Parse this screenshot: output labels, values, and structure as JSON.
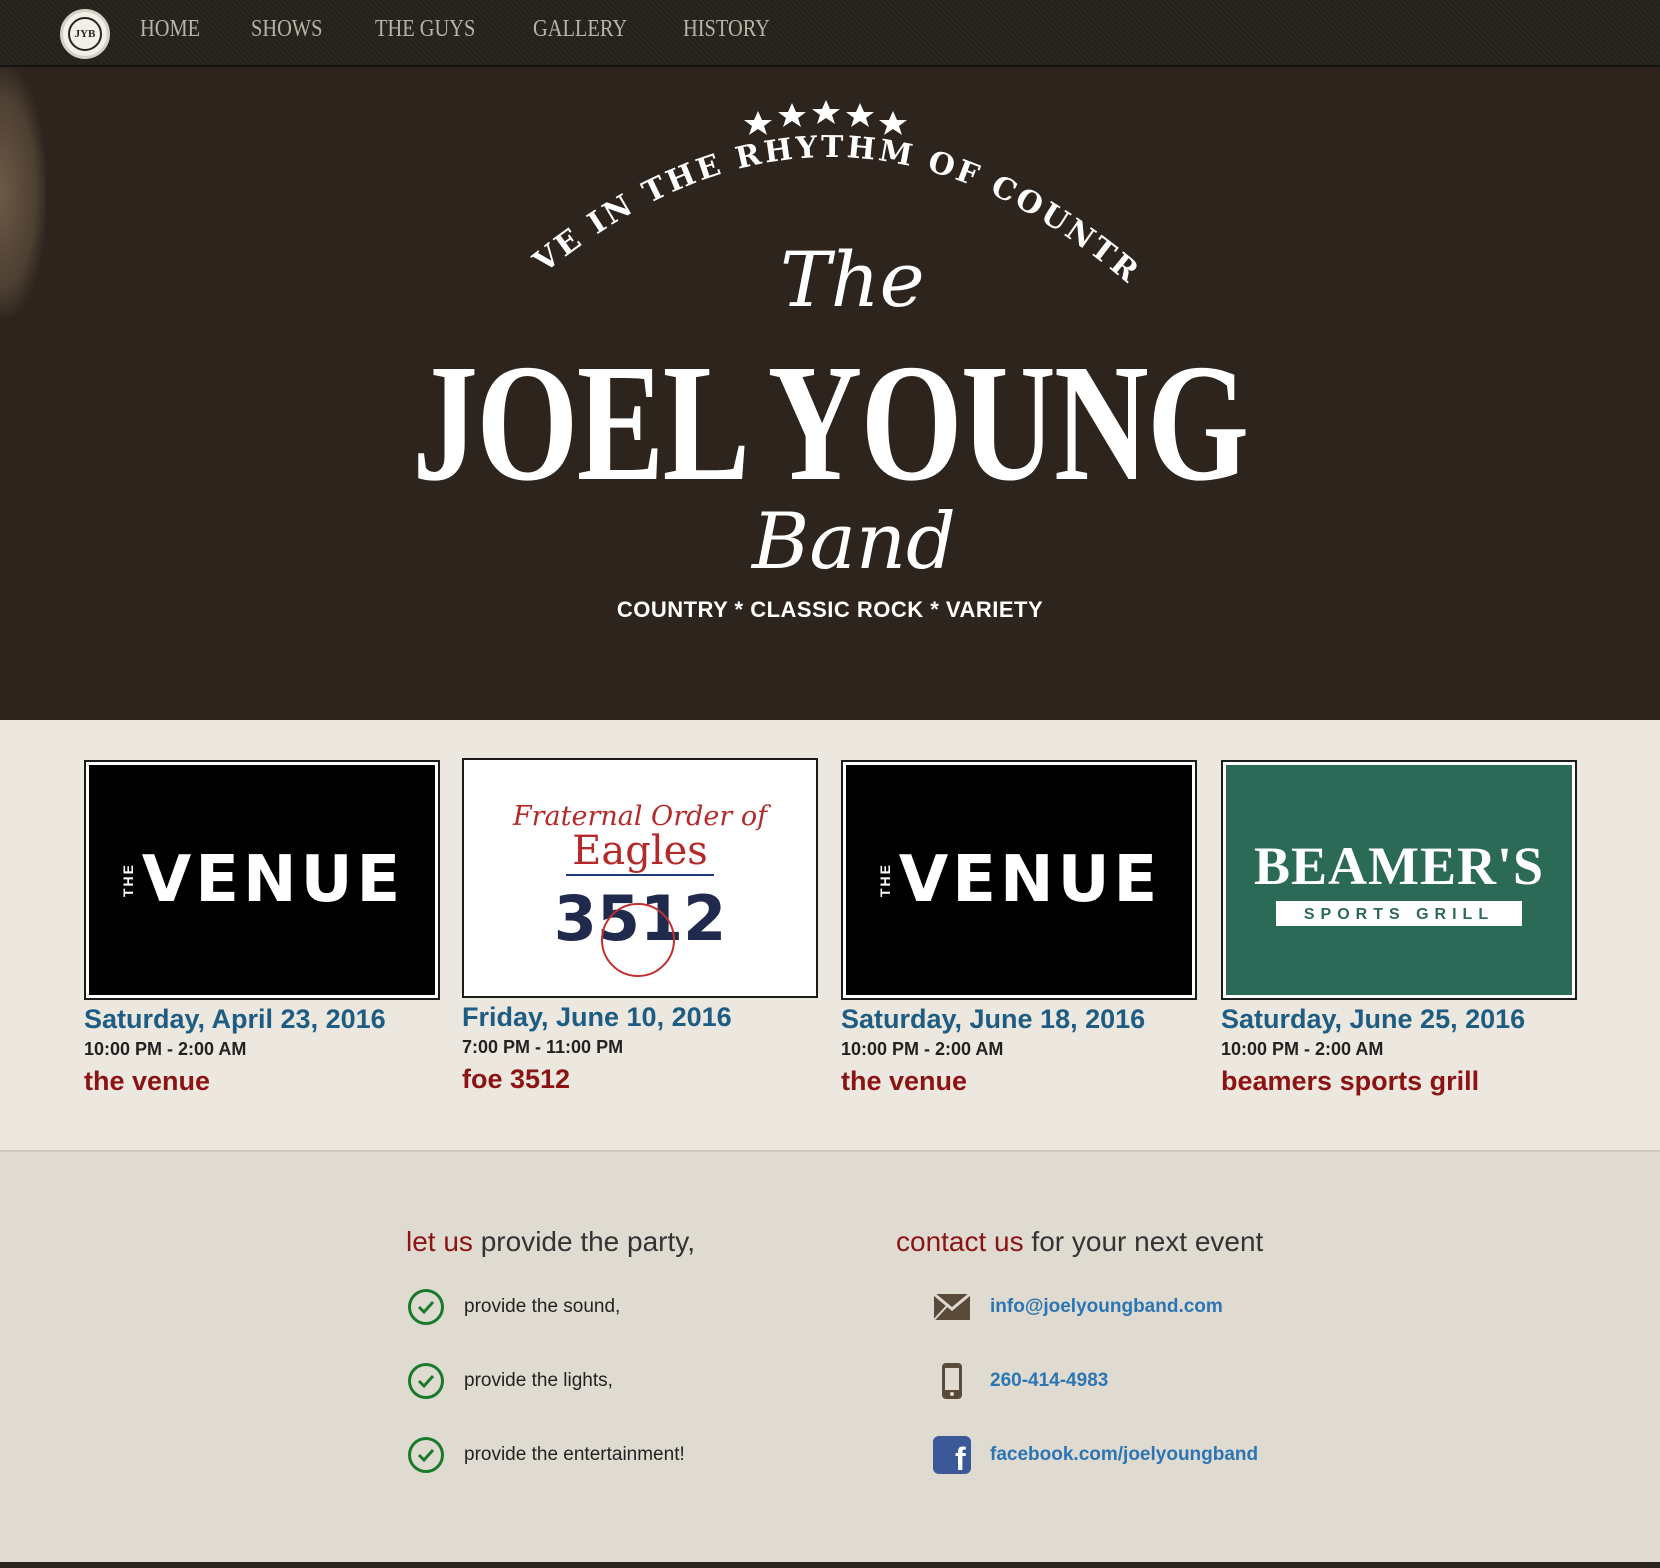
{
  "nav": {
    "logo_text": "JYB",
    "items": [
      {
        "label": "HOME"
      },
      {
        "label": "SHOWS"
      },
      {
        "label": "THE GUYS"
      },
      {
        "label": "GALLERY"
      },
      {
        "label": "HISTORY"
      }
    ]
  },
  "hero": {
    "arc_text": "LIVE IN THE RHYTHM OF COUNTRY",
    "the": "The",
    "name": "JOEL YOUNG",
    "band": "Band",
    "tagline": "COUNTRY * CLASSIC ROCK * VARIETY"
  },
  "shows": [
    {
      "logo": "venue",
      "logo_the": "THE",
      "logo_word": "VENUE",
      "date": "Saturday, April 23, 2016",
      "time": "10:00 PM - 2:00 AM",
      "place": "the venue"
    },
    {
      "logo": "eagles",
      "logo_line1": "Fraternal Order of",
      "logo_line2": "Eagles",
      "logo_num": "3512",
      "date": "Friday, June 10, 2016",
      "time": "7:00 PM - 11:00 PM",
      "place": "foe 3512"
    },
    {
      "logo": "venue",
      "logo_the": "THE",
      "logo_word": "VENUE",
      "date": "Saturday, June 18, 2016",
      "time": "10:00 PM - 2:00 AM",
      "place": "the venue"
    },
    {
      "logo": "beamers",
      "logo_line1": "BEAMER'S",
      "logo_line2": "SPORTS GRILL",
      "date": "Saturday, June 25, 2016",
      "time": "10:00 PM - 2:00 AM",
      "place": "beamers sports grill"
    }
  ],
  "cta": {
    "left": {
      "heading_red": "let us",
      "heading_rest": "provide the party,",
      "items": [
        "provide the sound,",
        "provide the lights,",
        "provide the entertainment!"
      ]
    },
    "right": {
      "heading_red": "contact us",
      "heading_rest": "for your next event",
      "email": "info@joelyoungband.com",
      "phone": "260-414-4983",
      "facebook": "facebook.com/joelyoungband"
    }
  },
  "colors": {
    "hero_bg": "#2d241d",
    "date_blue": "#1d5c83",
    "place_red": "#8c1313",
    "link_blue": "#2c75b5",
    "check_green": "#1a7a2c"
  }
}
